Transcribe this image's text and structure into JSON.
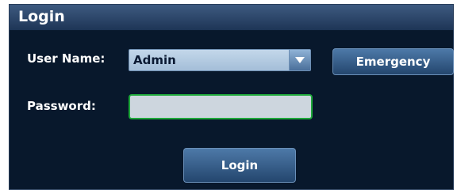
{
  "dialog": {
    "title": "Login"
  },
  "form": {
    "username_label": "User Name:",
    "username_value": "Admin",
    "password_label": "Password:",
    "password_value": ""
  },
  "buttons": {
    "emergency_label": "Emergency",
    "login_label": "Login"
  },
  "icons": {
    "dropdown": "chevron-down-icon"
  },
  "colors": {
    "background": "#08182c",
    "titlebar": "#2c4a70",
    "focus_border": "#1ea83a",
    "combo_fill": "#b4cbe2"
  }
}
